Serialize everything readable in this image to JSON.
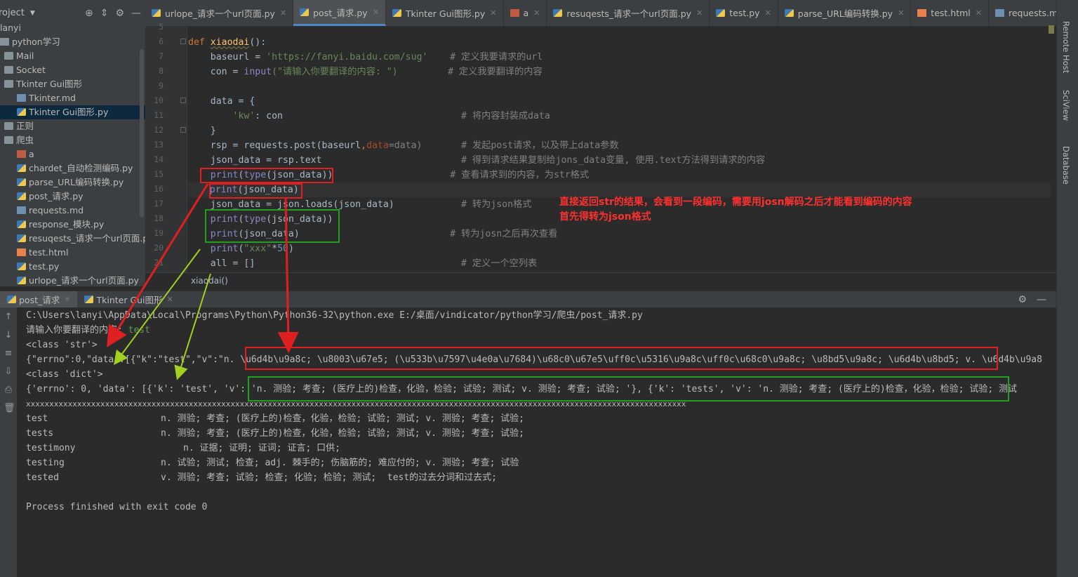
{
  "project": {
    "title": "roject",
    "tree": [
      {
        "label": "lanyi",
        "icon": "none",
        "indent": 0
      },
      {
        "label": "python学习",
        "icon": "folder",
        "indent": 0
      },
      {
        "label": "Mail",
        "icon": "folder",
        "indent": 1
      },
      {
        "label": "Socket",
        "icon": "folder",
        "indent": 1
      },
      {
        "label": "Tkinter Gui图形",
        "icon": "folder",
        "indent": 1
      },
      {
        "label": "Tkinter.md",
        "icon": "md",
        "indent": 2
      },
      {
        "label": "Tkinter Gui图形.py",
        "icon": "py",
        "indent": 2
      },
      {
        "label": "正则",
        "icon": "folder",
        "indent": 1
      },
      {
        "label": "爬虫",
        "icon": "folder",
        "indent": 1
      },
      {
        "label": "a",
        "icon": "a",
        "indent": 2
      },
      {
        "label": "chardet_自动检测编码.py",
        "icon": "py",
        "indent": 2
      },
      {
        "label": "parse_URL编码转换.py",
        "icon": "py",
        "indent": 2
      },
      {
        "label": "post_请求.py",
        "icon": "py",
        "indent": 2
      },
      {
        "label": "requests.md",
        "icon": "md",
        "indent": 2
      },
      {
        "label": "response_模块.py",
        "icon": "py",
        "indent": 2
      },
      {
        "label": "resuqests_请求一个url页面.py",
        "icon": "py",
        "indent": 2
      },
      {
        "label": "test.html",
        "icon": "html",
        "indent": 2
      },
      {
        "label": "test.py",
        "icon": "py",
        "indent": 2
      },
      {
        "label": "urlope_请求一个url页面.py",
        "icon": "py",
        "indent": 2
      }
    ]
  },
  "tabs": [
    {
      "label": "urlope_请求一个url页面.py",
      "icon": "py"
    },
    {
      "label": "post_请求.py",
      "icon": "py",
      "active": true
    },
    {
      "label": "Tkinter Gui图形.py",
      "icon": "py"
    },
    {
      "label": "a",
      "icon": "a"
    },
    {
      "label": "resuqests_请求一个url页面.py",
      "icon": "py"
    },
    {
      "label": "test.py",
      "icon": "py"
    },
    {
      "label": "parse_URL编码转换.py",
      "icon": "py"
    },
    {
      "label": "test.html",
      "icon": "html"
    },
    {
      "label": "requests.md",
      "icon": "md"
    }
  ],
  "line_numbers": [
    "5",
    "6",
    "7",
    "8",
    "9",
    "10",
    "11",
    "12",
    "13",
    "14",
    "15",
    "16",
    "17",
    "18",
    "19",
    "20",
    "21"
  ],
  "code": {
    "l6_kw": "def ",
    "l6_fn": "xiaodai",
    "l6_rest": "():",
    "l7_a": "    baseurl = ",
    "l7_s": "'https://fanyi.baidu.com/sug'",
    "l7_c": "    # 定义我要请求的url",
    "l8_a": "    con = ",
    "l8_b": "input",
    "l8_s": "(\"请输入你要翻译的内容: \")",
    "l8_c": "         # 定义我要翻译的内容",
    "l10": "    data = {",
    "l11_s": "        'kw'",
    "l11_a": ": con",
    "l11_c": "                                # 将内容封装成data",
    "l12": "    }",
    "l13_a": "    rsp = requests.post(baseurl",
    "l13_b": ",",
    "l13_k": "data",
    "l13_c": "=data)       # 发起post请求，以及带上data参数",
    "l14_a": "    json_data = rsp.text",
    "l14_c": "                         # 得到请求结果复制给jons_data变量, 使用.text方法得到请求的内容",
    "l15_b": "    print",
    "l15_a": "(",
    "l15_t": "type",
    "l15_r": "(json_data))",
    "l15_c": "                     # 查看请求到的内容，为str格式",
    "l16_b": "    print",
    "l16_r": "(json_data)",
    "l17_a": "    json_data = json.loads(json_data)",
    "l17_c": "            # 转为json格式",
    "l18_b": "    print",
    "l18_a": "(",
    "l18_t": "type",
    "l18_r": "(json_data))",
    "l19_b": "    print",
    "l19_r": "(json_data)",
    "l19_c": "                           # 转为josn之后再次查看",
    "l20_b": "    print",
    "l20_a": "(",
    "l20_s": "\"xxx\"",
    "l20_o": "*",
    "l20_n": "50",
    "l20_r": ")",
    "l21_a": "    all = []",
    "l21_c": "                                     # 定义一个空列表"
  },
  "breadcrumb": "xiaodai()",
  "right_tools": [
    "Remote Host",
    "SciView",
    "Database"
  ],
  "run": {
    "tabs": [
      {
        "label": "post_请求",
        "active": true
      },
      {
        "label": "Tkinter Gui图形"
      }
    ],
    "lines": {
      "cmd": "C:\\Users\\lanyi\\AppData\\Local\\Programs\\Python\\Python36-32\\python.exe E:/桌面/vindicator/python学习/爬虫/post_请求.py",
      "prompt": "请输入你要翻译的内容: ",
      "input": "test",
      "cls1": "<class 'str'>",
      "raw": "{\"errno\":0,\"data\":[{\"k\":\"test\",\"v\":\"n. \\u6d4b\\u9a8c; \\u8003\\u67e5; (\\u533b\\u7597\\u4e0a\\u7684)\\u68c0\\u67e5\\uff0c\\u5316\\u9a8c\\uff0c\\u68c0\\u9a8c; \\u8bd5\\u9a8c; \\u6d4b\\u8bd5; v. \\u6d4b\\u9a8",
      "cls2": "<class 'dict'>",
      "dict": "{'errno': 0, 'data': [{'k': 'test', 'v': 'n. 测验; 考查; (医疗上的)检查，化验，检验; 试验; 测试; v. 测验; 考查; 试验; '}, {'k': 'tests', 'v': 'n. 测验; 考查; (医疗上的)检查，化验，检验; 试验; 测试",
      "xs": "xxxxxxxxxxxxxxxxxxxxxxxxxxxxxxxxxxxxxxxxxxxxxxxxxxxxxxxxxxxxxxxxxxxxxxxxxxxxxxxxxxxxxxxxxxxxxxxxxxxxxxxxxxxxxxxxxxxxxxxxxxxxxxxxxxxxxxxxxxxxxx",
      "r1k": "test",
      "r1v": "n. 测验; 考查; (医疗上的)检查，化验，检验; 试验; 测试; v. 测验; 考查; 试验;",
      "r2k": "tests",
      "r2v": "n. 测验; 考查; (医疗上的)检查，化验，检验; 试验; 测试; v. 测验; 考查; 试验;",
      "r3k": "testimony",
      "r3v": "n. 证据; 证明; 证词; 证言; 口供;",
      "r4k": "testing",
      "r4v": "n. 试验; 测试; 检查; adj. 棘手的; 伤脑筋的; 难应付的; v. 测验; 考查; 试验",
      "r5k": "tested",
      "r5v": "v. 测验; 考查; 试验; 检查; 化验; 检验; 测试;  test的过去分词和过去式;",
      "exit": "Process finished with exit code 0"
    }
  },
  "annotation": {
    "line1": "直接返回str的结果，会看到一段编码，需要用josn解码之后才能看到编码的内容",
    "line2": "首先得转为json格式"
  },
  "colors": {
    "red": "#e02020",
    "green": "#20a020",
    "arrow_green": "#a0d020"
  }
}
